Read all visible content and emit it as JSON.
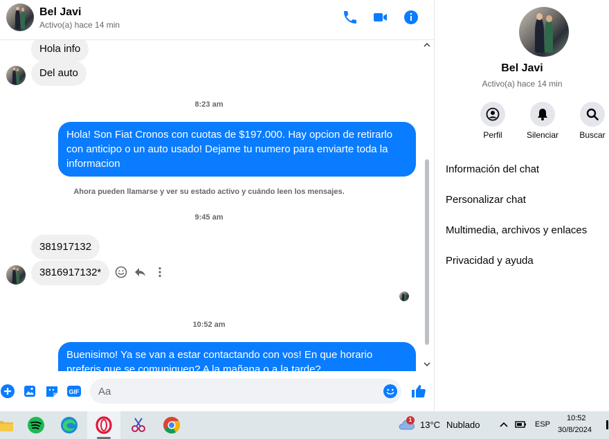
{
  "header": {
    "name": "Bel Javi",
    "status": "Activo(a) hace 14 min"
  },
  "messages": {
    "in1": "Hola info",
    "in2": "Del auto",
    "time1": "8:23 am",
    "out1": "Hola! Son Fiat Cronos con cuotas de $197.000. Hay opcion de retirarlo con anticipo o un auto usado! Dejame tu numero para enviarte toda la informacion",
    "system": "Ahora pueden llamarse y ver su estado activo y cuándo leen los mensajes.",
    "time2": "9:45 am",
    "in3": "381917132",
    "in4": "3816917132*",
    "time3": "10:52 am",
    "out2": "Buenisimo! Ya se van a estar contactando con vos! En que horario preferis que se comuniquen? A la mañana o a la tarde?"
  },
  "composer": {
    "placeholder": "Aa"
  },
  "sidebar": {
    "name": "Bel Javi",
    "status": "Activo(a) hace 14 min",
    "actions": [
      "Perfil",
      "Silenciar",
      "Buscar"
    ],
    "menu": [
      "Información del chat",
      "Personalizar chat",
      "Multimedia, archivos y enlaces",
      "Privacidad y ayuda"
    ]
  },
  "taskbar": {
    "weather_temp": "13°C",
    "weather_desc": "Nublado",
    "weather_badge": "1",
    "language": "ESP",
    "time": "10:52",
    "date": "30/8/2024"
  },
  "colors": {
    "accent": "#0a7cff",
    "in_bubble": "#f0f0f0"
  }
}
